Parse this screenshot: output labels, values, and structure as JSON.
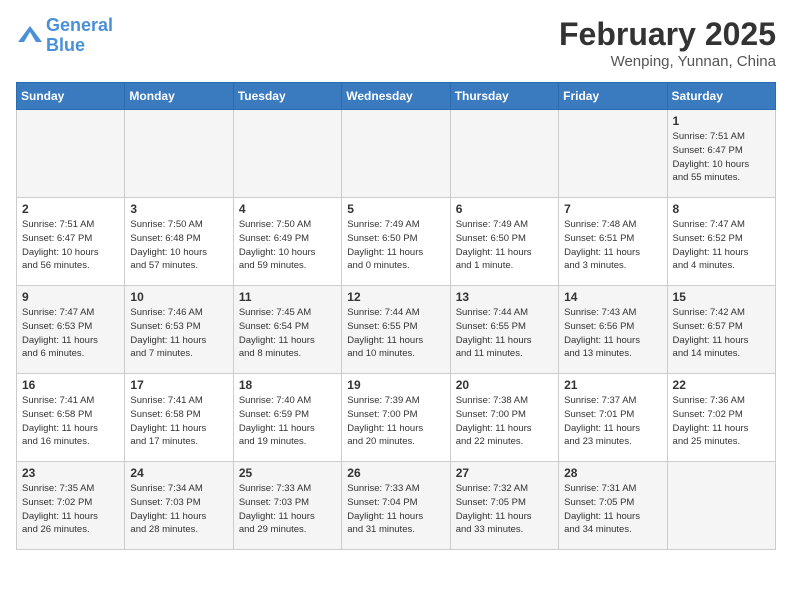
{
  "header": {
    "logo_line1": "General",
    "logo_line2": "Blue",
    "month_year": "February 2025",
    "location": "Wenping, Yunnan, China"
  },
  "weekdays": [
    "Sunday",
    "Monday",
    "Tuesday",
    "Wednesday",
    "Thursday",
    "Friday",
    "Saturday"
  ],
  "weeks": [
    [
      {
        "day": "",
        "info": ""
      },
      {
        "day": "",
        "info": ""
      },
      {
        "day": "",
        "info": ""
      },
      {
        "day": "",
        "info": ""
      },
      {
        "day": "",
        "info": ""
      },
      {
        "day": "",
        "info": ""
      },
      {
        "day": "1",
        "info": "Sunrise: 7:51 AM\nSunset: 6:47 PM\nDaylight: 10 hours\nand 55 minutes."
      }
    ],
    [
      {
        "day": "2",
        "info": "Sunrise: 7:51 AM\nSunset: 6:47 PM\nDaylight: 10 hours\nand 56 minutes."
      },
      {
        "day": "3",
        "info": "Sunrise: 7:50 AM\nSunset: 6:48 PM\nDaylight: 10 hours\nand 57 minutes."
      },
      {
        "day": "4",
        "info": "Sunrise: 7:50 AM\nSunset: 6:49 PM\nDaylight: 10 hours\nand 59 minutes."
      },
      {
        "day": "5",
        "info": "Sunrise: 7:49 AM\nSunset: 6:50 PM\nDaylight: 11 hours\nand 0 minutes."
      },
      {
        "day": "6",
        "info": "Sunrise: 7:49 AM\nSunset: 6:50 PM\nDaylight: 11 hours\nand 1 minute."
      },
      {
        "day": "7",
        "info": "Sunrise: 7:48 AM\nSunset: 6:51 PM\nDaylight: 11 hours\nand 3 minutes."
      },
      {
        "day": "8",
        "info": "Sunrise: 7:47 AM\nSunset: 6:52 PM\nDaylight: 11 hours\nand 4 minutes."
      }
    ],
    [
      {
        "day": "9",
        "info": "Sunrise: 7:47 AM\nSunset: 6:53 PM\nDaylight: 11 hours\nand 6 minutes."
      },
      {
        "day": "10",
        "info": "Sunrise: 7:46 AM\nSunset: 6:53 PM\nDaylight: 11 hours\nand 7 minutes."
      },
      {
        "day": "11",
        "info": "Sunrise: 7:45 AM\nSunset: 6:54 PM\nDaylight: 11 hours\nand 8 minutes."
      },
      {
        "day": "12",
        "info": "Sunrise: 7:44 AM\nSunset: 6:55 PM\nDaylight: 11 hours\nand 10 minutes."
      },
      {
        "day": "13",
        "info": "Sunrise: 7:44 AM\nSunset: 6:55 PM\nDaylight: 11 hours\nand 11 minutes."
      },
      {
        "day": "14",
        "info": "Sunrise: 7:43 AM\nSunset: 6:56 PM\nDaylight: 11 hours\nand 13 minutes."
      },
      {
        "day": "15",
        "info": "Sunrise: 7:42 AM\nSunset: 6:57 PM\nDaylight: 11 hours\nand 14 minutes."
      }
    ],
    [
      {
        "day": "16",
        "info": "Sunrise: 7:41 AM\nSunset: 6:58 PM\nDaylight: 11 hours\nand 16 minutes."
      },
      {
        "day": "17",
        "info": "Sunrise: 7:41 AM\nSunset: 6:58 PM\nDaylight: 11 hours\nand 17 minutes."
      },
      {
        "day": "18",
        "info": "Sunrise: 7:40 AM\nSunset: 6:59 PM\nDaylight: 11 hours\nand 19 minutes."
      },
      {
        "day": "19",
        "info": "Sunrise: 7:39 AM\nSunset: 7:00 PM\nDaylight: 11 hours\nand 20 minutes."
      },
      {
        "day": "20",
        "info": "Sunrise: 7:38 AM\nSunset: 7:00 PM\nDaylight: 11 hours\nand 22 minutes."
      },
      {
        "day": "21",
        "info": "Sunrise: 7:37 AM\nSunset: 7:01 PM\nDaylight: 11 hours\nand 23 minutes."
      },
      {
        "day": "22",
        "info": "Sunrise: 7:36 AM\nSunset: 7:02 PM\nDaylight: 11 hours\nand 25 minutes."
      }
    ],
    [
      {
        "day": "23",
        "info": "Sunrise: 7:35 AM\nSunset: 7:02 PM\nDaylight: 11 hours\nand 26 minutes."
      },
      {
        "day": "24",
        "info": "Sunrise: 7:34 AM\nSunset: 7:03 PM\nDaylight: 11 hours\nand 28 minutes."
      },
      {
        "day": "25",
        "info": "Sunrise: 7:33 AM\nSunset: 7:03 PM\nDaylight: 11 hours\nand 29 minutes."
      },
      {
        "day": "26",
        "info": "Sunrise: 7:33 AM\nSunset: 7:04 PM\nDaylight: 11 hours\nand 31 minutes."
      },
      {
        "day": "27",
        "info": "Sunrise: 7:32 AM\nSunset: 7:05 PM\nDaylight: 11 hours\nand 33 minutes."
      },
      {
        "day": "28",
        "info": "Sunrise: 7:31 AM\nSunset: 7:05 PM\nDaylight: 11 hours\nand 34 minutes."
      },
      {
        "day": "",
        "info": ""
      }
    ]
  ]
}
